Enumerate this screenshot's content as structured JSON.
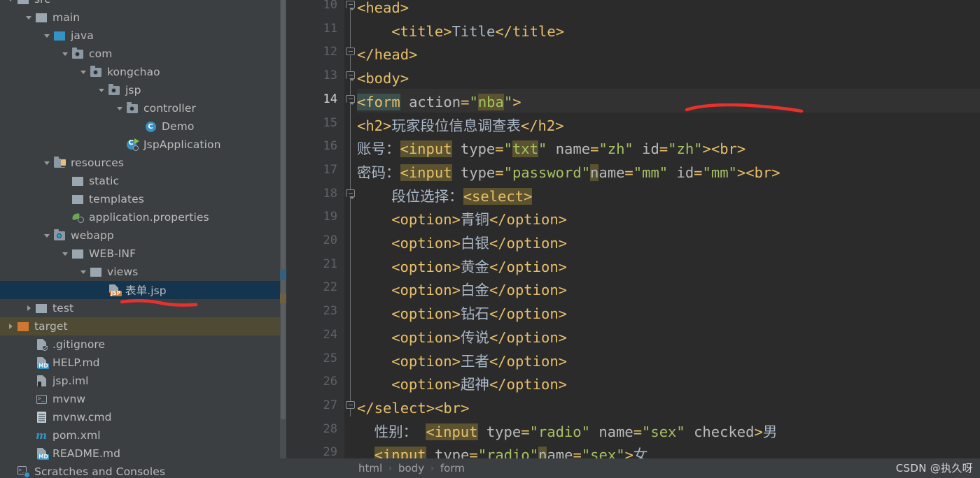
{
  "tree": {
    "items": [
      {
        "label": "src",
        "indent": 0,
        "arrow": "down",
        "icon": "folder-grey",
        "state": "clipped"
      },
      {
        "label": "main",
        "indent": 1,
        "arrow": "down",
        "icon": "folder-grey",
        "state": "normal"
      },
      {
        "label": "java",
        "indent": 2,
        "arrow": "down",
        "icon": "folder-blue",
        "state": "normal"
      },
      {
        "label": "com",
        "indent": 3,
        "arrow": "down",
        "icon": "package",
        "state": "normal"
      },
      {
        "label": "kongchao",
        "indent": 4,
        "arrow": "down",
        "icon": "package",
        "state": "normal"
      },
      {
        "label": "jsp",
        "indent": 5,
        "arrow": "down",
        "icon": "package",
        "state": "normal"
      },
      {
        "label": "controller",
        "indent": 6,
        "arrow": "down",
        "icon": "package",
        "state": "normal"
      },
      {
        "label": "Demo",
        "indent": 7,
        "arrow": "none",
        "icon": "class",
        "state": "normal"
      },
      {
        "label": "JspApplication",
        "indent": 6,
        "arrow": "none",
        "icon": "spring-app",
        "state": "normal"
      },
      {
        "label": "resources",
        "indent": 2,
        "arrow": "down",
        "icon": "resources-folder",
        "state": "normal"
      },
      {
        "label": "static",
        "indent": 3,
        "arrow": "none",
        "icon": "folder-grey",
        "state": "normal"
      },
      {
        "label": "templates",
        "indent": 3,
        "arrow": "none",
        "icon": "folder-grey",
        "state": "normal"
      },
      {
        "label": "application.properties",
        "indent": 3,
        "arrow": "none",
        "icon": "properties",
        "state": "normal"
      },
      {
        "label": "webapp",
        "indent": 2,
        "arrow": "down",
        "icon": "package-cyan",
        "state": "normal"
      },
      {
        "label": "WEB-INF",
        "indent": 3,
        "arrow": "down",
        "icon": "folder-grey",
        "state": "normal"
      },
      {
        "label": "views",
        "indent": 4,
        "arrow": "down",
        "icon": "folder-grey",
        "state": "normal"
      },
      {
        "label": "表单.jsp",
        "indent": 5,
        "arrow": "none",
        "icon": "jsp-file",
        "state": "selected"
      },
      {
        "label": "test",
        "indent": 1,
        "arrow": "right",
        "icon": "folder-grey",
        "state": "normal"
      },
      {
        "label": "target",
        "indent": 0,
        "arrow": "right",
        "icon": "folder-orange",
        "state": "highlighted"
      },
      {
        "label": ".gitignore",
        "indent": 1,
        "arrow": "none",
        "icon": "gitignore",
        "state": "normal"
      },
      {
        "label": "HELP.md",
        "indent": 1,
        "arrow": "none",
        "icon": "md-file",
        "state": "normal"
      },
      {
        "label": "jsp.iml",
        "indent": 1,
        "arrow": "none",
        "icon": "iml-file",
        "state": "normal"
      },
      {
        "label": "mvnw",
        "indent": 1,
        "arrow": "none",
        "icon": "shell-file",
        "state": "normal"
      },
      {
        "label": "mvnw.cmd",
        "indent": 1,
        "arrow": "none",
        "icon": "cmd-file",
        "state": "normal"
      },
      {
        "label": "pom.xml",
        "indent": 1,
        "arrow": "none",
        "icon": "maven-file",
        "state": "normal"
      },
      {
        "label": "README.md",
        "indent": 1,
        "arrow": "none",
        "icon": "md-file",
        "state": "normal"
      },
      {
        "label": "Scratches and Consoles",
        "indent": 0,
        "arrow": "none",
        "icon": "scratches",
        "state": "normal"
      }
    ]
  },
  "editor": {
    "first_line_number": 10,
    "current_line_number": 14,
    "lines": [
      {
        "n": 10,
        "indent": 0,
        "fold": "open",
        "spans": [
          {
            "t": "<head>",
            "c": "tag"
          }
        ]
      },
      {
        "n": 11,
        "indent": 4,
        "fold": "none",
        "spans": [
          {
            "t": "<title>",
            "c": "tag"
          },
          {
            "t": "Title",
            "c": "txt"
          },
          {
            "t": "</title>",
            "c": "tag"
          }
        ]
      },
      {
        "n": 12,
        "indent": 0,
        "fold": "close",
        "spans": [
          {
            "t": "</head>",
            "c": "tag"
          }
        ]
      },
      {
        "n": 13,
        "indent": 0,
        "fold": "open",
        "spans": [
          {
            "t": "<body>",
            "c": "tag"
          }
        ]
      },
      {
        "n": 14,
        "indent": 0,
        "fold": "open",
        "spans": [
          {
            "t": "<form",
            "c": "tag",
            "hl": "teal"
          },
          {
            "t": " ",
            "c": "attr"
          },
          {
            "t": "action",
            "c": "attr"
          },
          {
            "t": "=",
            "c": "tag"
          },
          {
            "t": "\"",
            "c": "val"
          },
          {
            "t": "nba",
            "c": "val",
            "hl": "olive"
          },
          {
            "t": "\"",
            "c": "val"
          },
          {
            "t": ">",
            "c": "tag"
          }
        ]
      },
      {
        "n": 15,
        "indent": 0,
        "fold": "none",
        "spans": [
          {
            "t": "<h2>",
            "c": "tag"
          },
          {
            "t": "玩家段位信息调查表",
            "c": "txt"
          },
          {
            "t": "</h2>",
            "c": "tag"
          }
        ]
      },
      {
        "n": 16,
        "indent": 0,
        "fold": "none",
        "spans": [
          {
            "t": "账号：",
            "c": "txt"
          },
          {
            "t": "<input",
            "c": "tag",
            "hl": "olive"
          },
          {
            "t": " ",
            "c": "attr"
          },
          {
            "t": "type",
            "c": "attr"
          },
          {
            "t": "=",
            "c": "tag"
          },
          {
            "t": "\"",
            "c": "val"
          },
          {
            "t": "txt",
            "c": "val",
            "hl": "olive"
          },
          {
            "t": "\"",
            "c": "val"
          },
          {
            "t": " ",
            "c": "attr"
          },
          {
            "t": "name",
            "c": "attr"
          },
          {
            "t": "=",
            "c": "tag"
          },
          {
            "t": "\"zh\"",
            "c": "val"
          },
          {
            "t": " ",
            "c": "attr"
          },
          {
            "t": "id",
            "c": "attr"
          },
          {
            "t": "=",
            "c": "tag"
          },
          {
            "t": "\"zh\"",
            "c": "val"
          },
          {
            "t": ">",
            "c": "tag"
          },
          {
            "t": "<br>",
            "c": "tag"
          }
        ]
      },
      {
        "n": 17,
        "indent": 0,
        "fold": "none",
        "spans": [
          {
            "t": "密码：",
            "c": "txt"
          },
          {
            "t": "<input",
            "c": "tag",
            "hl": "olive"
          },
          {
            "t": " ",
            "c": "attr"
          },
          {
            "t": "type",
            "c": "attr"
          },
          {
            "t": "=",
            "c": "tag"
          },
          {
            "t": "\"password\"",
            "c": "val"
          },
          {
            "t": "n",
            "c": "attr",
            "hl": "olive"
          },
          {
            "t": "ame",
            "c": "attr"
          },
          {
            "t": "=",
            "c": "tag"
          },
          {
            "t": "\"mm\"",
            "c": "val"
          },
          {
            "t": " ",
            "c": "attr"
          },
          {
            "t": "id",
            "c": "attr"
          },
          {
            "t": "=",
            "c": "tag"
          },
          {
            "t": "\"mm\"",
            "c": "val"
          },
          {
            "t": ">",
            "c": "tag"
          },
          {
            "t": "<br>",
            "c": "tag"
          }
        ]
      },
      {
        "n": 18,
        "indent": 4,
        "fold": "open",
        "spans": [
          {
            "t": "段位选择：",
            "c": "txt"
          },
          {
            "t": "<select>",
            "c": "tag",
            "hl": "olive"
          }
        ]
      },
      {
        "n": 19,
        "indent": 4,
        "fold": "none",
        "spans": [
          {
            "t": "<option>",
            "c": "tag"
          },
          {
            "t": "青铜",
            "c": "txt"
          },
          {
            "t": "</option>",
            "c": "tag"
          }
        ]
      },
      {
        "n": 20,
        "indent": 4,
        "fold": "none",
        "spans": [
          {
            "t": "<option>",
            "c": "tag"
          },
          {
            "t": "白银",
            "c": "txt"
          },
          {
            "t": "</option>",
            "c": "tag"
          }
        ]
      },
      {
        "n": 21,
        "indent": 4,
        "fold": "none",
        "spans": [
          {
            "t": "<option>",
            "c": "tag"
          },
          {
            "t": "黄金",
            "c": "txt"
          },
          {
            "t": "</option>",
            "c": "tag"
          }
        ]
      },
      {
        "n": 22,
        "indent": 4,
        "fold": "none",
        "spans": [
          {
            "t": "<option>",
            "c": "tag"
          },
          {
            "t": "白金",
            "c": "txt"
          },
          {
            "t": "</option>",
            "c": "tag"
          }
        ]
      },
      {
        "n": 23,
        "indent": 4,
        "fold": "none",
        "spans": [
          {
            "t": "<option>",
            "c": "tag"
          },
          {
            "t": "钻石",
            "c": "txt"
          },
          {
            "t": "</option>",
            "c": "tag"
          }
        ]
      },
      {
        "n": 24,
        "indent": 4,
        "fold": "none",
        "spans": [
          {
            "t": "<option>",
            "c": "tag"
          },
          {
            "t": "传说",
            "c": "txt"
          },
          {
            "t": "</option>",
            "c": "tag"
          }
        ]
      },
      {
        "n": 25,
        "indent": 4,
        "fold": "none",
        "spans": [
          {
            "t": "<option>",
            "c": "tag"
          },
          {
            "t": "王者",
            "c": "txt"
          },
          {
            "t": "</option>",
            "c": "tag"
          }
        ]
      },
      {
        "n": 26,
        "indent": 4,
        "fold": "none",
        "spans": [
          {
            "t": "<option>",
            "c": "tag"
          },
          {
            "t": "超神",
            "c": "txt"
          },
          {
            "t": "</option>",
            "c": "tag"
          }
        ]
      },
      {
        "n": 27,
        "indent": 0,
        "fold": "close",
        "spans": [
          {
            "t": "</select>",
            "c": "tag"
          },
          {
            "t": "<br>",
            "c": "tag"
          }
        ]
      },
      {
        "n": 28,
        "indent": 2,
        "fold": "none",
        "spans": [
          {
            "t": "性别： ",
            "c": "txt"
          },
          {
            "t": "<input",
            "c": "tag",
            "hl": "olive"
          },
          {
            "t": " ",
            "c": "attr"
          },
          {
            "t": "type",
            "c": "attr"
          },
          {
            "t": "=",
            "c": "tag"
          },
          {
            "t": "\"radio\"",
            "c": "val"
          },
          {
            "t": " ",
            "c": "attr"
          },
          {
            "t": "name",
            "c": "attr"
          },
          {
            "t": "=",
            "c": "tag"
          },
          {
            "t": "\"sex\"",
            "c": "val"
          },
          {
            "t": " ",
            "c": "attr"
          },
          {
            "t": "checked",
            "c": "attr"
          },
          {
            "t": ">",
            "c": "tag"
          },
          {
            "t": "男",
            "c": "txt"
          }
        ]
      },
      {
        "n": 29,
        "indent": 2,
        "fold": "none",
        "spans": [
          {
            "t": "<input",
            "c": "tag",
            "hl": "olive"
          },
          {
            "t": " ",
            "c": "attr"
          },
          {
            "t": "type",
            "c": "attr"
          },
          {
            "t": "=",
            "c": "tag"
          },
          {
            "t": "\"radio\"",
            "c": "val"
          },
          {
            "t": "n",
            "c": "attr",
            "hl": "olive"
          },
          {
            "t": "ame",
            "c": "attr"
          },
          {
            "t": "=",
            "c": "tag"
          },
          {
            "t": "\"sex\"",
            "c": "val"
          },
          {
            "t": ">",
            "c": "tag"
          },
          {
            "t": "女",
            "c": "txt"
          }
        ]
      }
    ]
  },
  "breadcrumb": {
    "items": [
      "html",
      "body",
      "form"
    ],
    "separator": "›"
  },
  "watermark": {
    "text": "CSDN @执久呀"
  },
  "colors": {
    "editor_bg": "#2b2b2b",
    "panel_bg": "#3c3f41",
    "gutter_bg": "#313335",
    "selection_bg": "#15354e",
    "highlight_olive": "#4e4a33",
    "tag": "#e8bf6a",
    "value": "#a5c261",
    "text": "#a9b7c6",
    "annotation_red": "#e8312c"
  }
}
